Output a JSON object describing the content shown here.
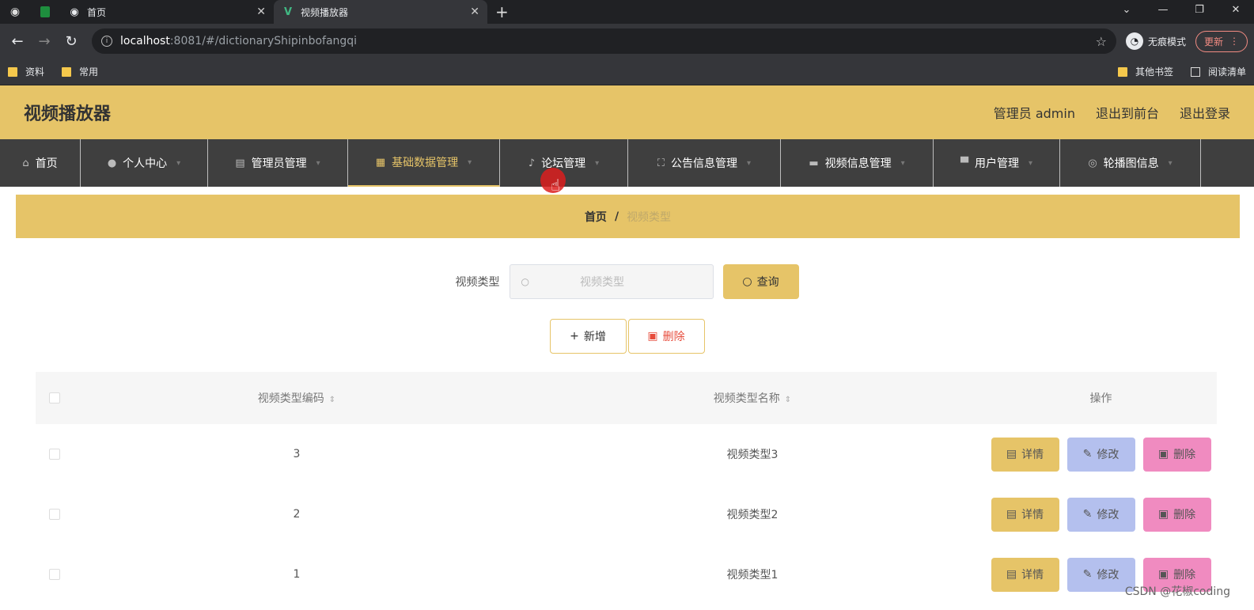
{
  "browser": {
    "tabs": [
      {
        "title": "首页",
        "icon": "globe-icon"
      },
      {
        "title": "视频播放器",
        "icon": "vue-icon"
      }
    ],
    "url_host": "localhost",
    "url_path": ":8081/#/dictionaryShipinbofangqi",
    "incognito_label": "无痕模式",
    "update_label": "更新",
    "bookmarks": [
      "资料",
      "常用"
    ],
    "bookmarks_right": [
      "其他书签",
      "阅读清单"
    ]
  },
  "app": {
    "title": "视频播放器",
    "header_links": [
      "管理员 admin",
      "退出到前台",
      "退出登录"
    ],
    "nav": [
      {
        "label": "首页",
        "icon": "home-icon"
      },
      {
        "label": "个人中心",
        "icon": "user-icon"
      },
      {
        "label": "管理员管理",
        "icon": "clipboard-icon"
      },
      {
        "label": "基础数据管理",
        "icon": "grid-icon"
      },
      {
        "label": "论坛管理",
        "icon": "microphone-icon"
      },
      {
        "label": "公告信息管理",
        "icon": "frame-icon"
      },
      {
        "label": "视频信息管理",
        "icon": "message-icon"
      },
      {
        "label": "用户管理",
        "icon": "users-icon"
      },
      {
        "label": "轮播图信息",
        "icon": "carousel-icon"
      }
    ],
    "active_nav": "基础数据管理"
  },
  "breadcrumb": {
    "home": "首页",
    "sep": "/",
    "current": "视频类型"
  },
  "search": {
    "label": "视频类型",
    "placeholder": "视频类型",
    "button": "查询"
  },
  "actions": {
    "add": "新增",
    "delete": "删除"
  },
  "table": {
    "columns": [
      "视频类型编码",
      "视频类型名称",
      "操作"
    ],
    "rows": [
      {
        "code": "3",
        "name": "视频类型3"
      },
      {
        "code": "2",
        "name": "视频类型2"
      },
      {
        "code": "1",
        "name": "视频类型1"
      }
    ],
    "row_actions": {
      "detail": "详情",
      "edit": "修改",
      "remove": "删除"
    }
  },
  "watermark": "CSDN @花椒coding",
  "colors": {
    "accent": "#e6c468",
    "nav_bg": "#3f3f3f",
    "edit": "#b4c0ee",
    "remove": "#f08bc0"
  }
}
